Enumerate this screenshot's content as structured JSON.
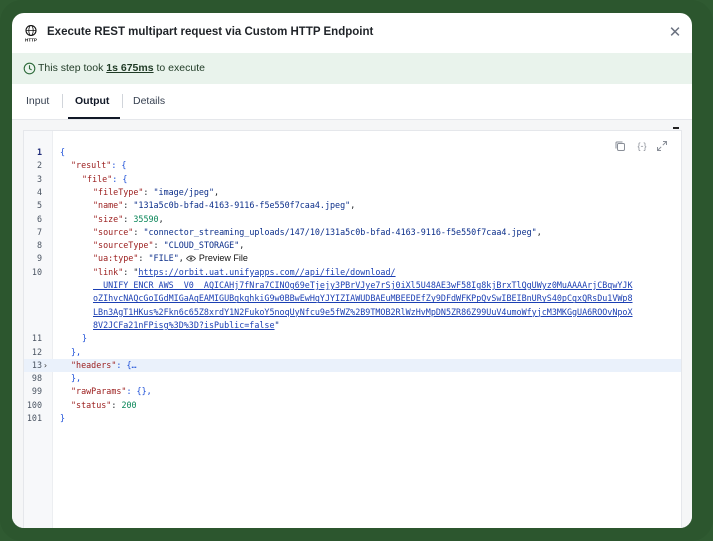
{
  "header": {
    "title_prefix": "Execute REST multipart request via ",
    "title_suffix": "Custom HTTP Endpoint",
    "icon": "http-icon",
    "close_label": "✕"
  },
  "banner": {
    "text_before": "This step took ",
    "duration": "1s 675ms",
    "text_after": " to execute",
    "icon": "clock-icon"
  },
  "tabs": [
    {
      "label": "Input"
    },
    {
      "label": "Output"
    },
    {
      "label": "Details"
    }
  ],
  "active_tab": "Output",
  "toolbar": {
    "icons": [
      "copy-icon",
      "code-format-icon",
      "expand-icon"
    ],
    "format_label": "{-}"
  },
  "code": {
    "lines": [
      {
        "n": "1",
        "t": "{"
      },
      {
        "n": "2",
        "k": "\"result\"",
        "t": ": {"
      },
      {
        "n": "3",
        "k": "\"file\"",
        "t": ": {"
      },
      {
        "n": "4",
        "k": "\"fileType\"",
        "s": "\"image/jpeg\"",
        "e": ","
      },
      {
        "n": "5",
        "k": "\"name\"",
        "s": "\"131a5c0b-bfad-4163-9116-f5e550f7caa4.jpeg\"",
        "e": ","
      },
      {
        "n": "6",
        "k": "\"size\"",
        "num": "35590",
        "e": ","
      },
      {
        "n": "7",
        "k": "\"source\"",
        "s": "\"connector_streaming_uploads/147/10/131a5c0b-bfad-4163-9116-f5e550f7caa4.jpeg\"",
        "e": ","
      },
      {
        "n": "8",
        "k": "\"sourceType\"",
        "s": "\"CLOUD_STORAGE\"",
        "e": ","
      },
      {
        "n": "9",
        "k": "\"ua:type\"",
        "s": "\"FILE\"",
        "e": ",",
        "preview": "Preview File"
      },
      {
        "n": "10",
        "k": "\"link\"",
        "link": [
          "https://orbit.uat.unifyapps.com//api/file/download/",
          "__UNIFY_ENCR_AWS__V0__AQICAHj7fNra7CINOg69eTjejy3PBrVJye7rSj0iXl5U48AE3wF58Ig8kjBrxTlQgUWyz0MuAAAArjCBqwYJK",
          "oZIhvcNAQcGoIGdMIGaAgEAMIGUBgkqhkiG9w0BBwEwHgYJYIZIAWUDBAEuMBEEDEfZy9DFdWFKPpQvSwIBEIBnURyS40pCgxQRsDu1VWp8",
          "LBn3AgT1HKus%2Fkn6c65Z8xrdY1N2FukoY5noqUyNfcu9e5fWZ%2B9TMOB2RlWzHvMpDN5ZR86Z99UuV4umoWfyjcM3MKGgUA6ROOvNpoX",
          "8V2JCFa21nFPisg%3D%3D?isPublic=false"
        ]
      },
      {
        "n": "11",
        "t": "}"
      },
      {
        "n": "12",
        "t": "},"
      },
      {
        "n": "13",
        "k": "\"headers\"",
        "t": ": {…",
        "fold": "›"
      },
      {
        "n": "98",
        "t": "},"
      },
      {
        "n": "99",
        "k": "\"rawParams\"",
        "t": ": {},"
      },
      {
        "n": "100",
        "k": "\"status\"",
        "num": "200"
      },
      {
        "n": "101",
        "t": "}"
      }
    ]
  }
}
